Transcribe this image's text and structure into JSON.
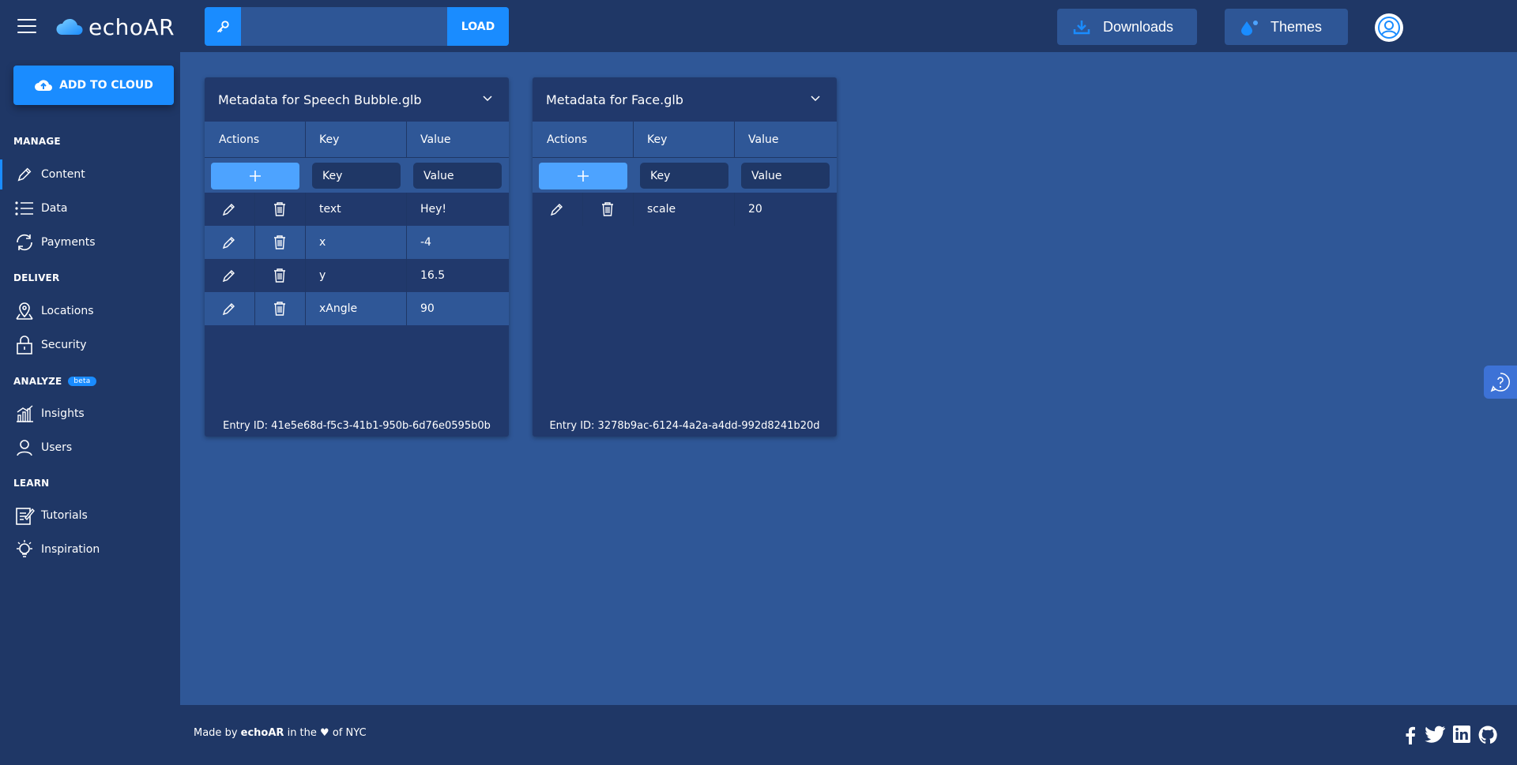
{
  "app": {
    "logo_text": "echoAR"
  },
  "header": {
    "api_key_value": "",
    "load_label": "LOAD",
    "downloads_label": "Downloads",
    "themes_label": "Themes"
  },
  "sidebar": {
    "add_to_cloud_label": "ADD TO CLOUD",
    "sections": {
      "manage": "MANAGE",
      "deliver": "DELIVER",
      "analyze": "ANALYZE",
      "analyze_badge": "beta",
      "learn": "LEARN"
    },
    "items": [
      {
        "label": "Content",
        "icon": "pencil-icon",
        "active": true
      },
      {
        "label": "Data",
        "icon": "list-icon"
      },
      {
        "label": "Payments",
        "icon": "refresh-icon"
      },
      {
        "label": "Locations",
        "icon": "map-pin-icon"
      },
      {
        "label": "Security",
        "icon": "lock-icon"
      },
      {
        "label": "Insights",
        "icon": "bar-chart-icon"
      },
      {
        "label": "Users",
        "icon": "user-icon"
      },
      {
        "label": "Tutorials",
        "icon": "notepad-icon"
      },
      {
        "label": "Inspiration",
        "icon": "lightbulb-icon"
      }
    ]
  },
  "cards": [
    {
      "title": "Metadata for Speech Bubble.glb",
      "headers": {
        "actions": "Actions",
        "key": "Key",
        "value": "Value"
      },
      "inputs": {
        "key_placeholder": "Key",
        "value_placeholder": "Value"
      },
      "rows": [
        {
          "key": "text",
          "value": "Hey!"
        },
        {
          "key": "x",
          "value": "-4"
        },
        {
          "key": "y",
          "value": "16.5"
        },
        {
          "key": "xAngle",
          "value": "90"
        }
      ],
      "entry_id": "Entry ID: 41e5e68d-f5c3-41b1-950b-6d76e0595b0b"
    },
    {
      "title": "Metadata for Face.glb",
      "headers": {
        "actions": "Actions",
        "key": "Key",
        "value": "Value"
      },
      "inputs": {
        "key_placeholder": "Key",
        "value_placeholder": "Value"
      },
      "rows": [
        {
          "key": "scale",
          "value": "20"
        }
      ],
      "entry_id": "Entry ID: 3278b9ac-6124-4a2a-a4dd-992d8241b20d"
    }
  ],
  "footer": {
    "made_by": "Made by",
    "brand": "echoAR",
    "in_the": "in the",
    "heart": "♥",
    "of_nyc": "of NYC"
  },
  "colors": {
    "accent": "#1a8cff",
    "sidebar_bg": "#1f3766",
    "main_bg": "#2f5797",
    "card_bg": "#21396c"
  }
}
